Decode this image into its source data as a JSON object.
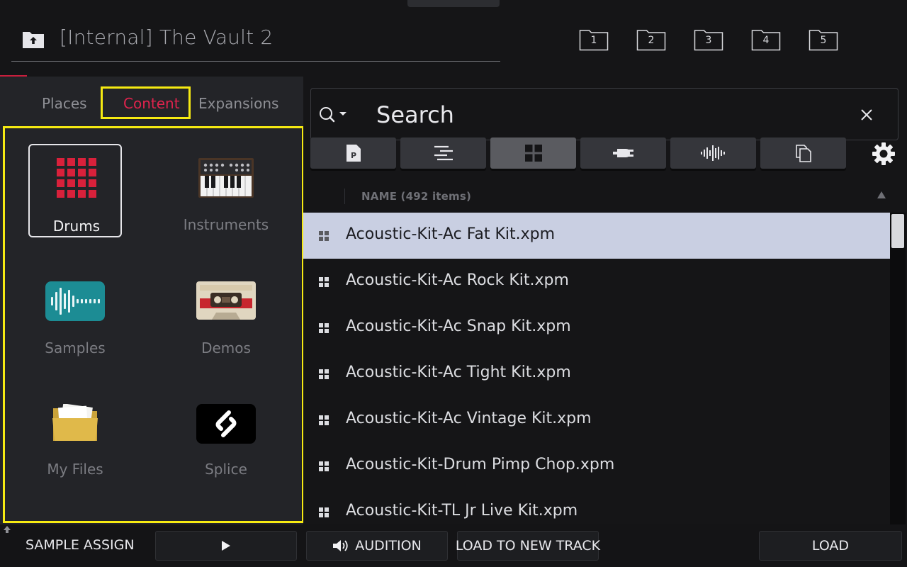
{
  "header": {
    "path_title": "[Internal] The Vault 2",
    "favorites": [
      "1",
      "2",
      "3",
      "4",
      "5"
    ]
  },
  "left": {
    "tabs": {
      "places": "Places",
      "content": "Content",
      "expansions": "Expansions"
    },
    "active_tab": "Content",
    "items": [
      {
        "label": "Drums",
        "icon": "drum-pads-icon",
        "selected": true
      },
      {
        "label": "Instruments",
        "icon": "synth-keyboard-icon"
      },
      {
        "label": "Samples",
        "icon": "waveform-icon"
      },
      {
        "label": "Demos",
        "icon": "cassette-icon"
      },
      {
        "label": "My Files",
        "icon": "folder-icon"
      },
      {
        "label": "Splice",
        "icon": "splice-logo-icon"
      }
    ]
  },
  "search": {
    "placeholder": "Search"
  },
  "filter_tabs": [
    {
      "icon": "program-file-icon"
    },
    {
      "icon": "sequence-list-icon"
    },
    {
      "icon": "kit-grid-icon",
      "active": true
    },
    {
      "icon": "plugin-icon"
    },
    {
      "icon": "sample-waveform-icon"
    },
    {
      "icon": "copy-files-icon"
    }
  ],
  "list": {
    "column_header": "NAME (492 items)",
    "rows": [
      "Acoustic-Kit-Ac Fat Kit.xpm",
      "Acoustic-Kit-Ac Rock Kit.xpm",
      "Acoustic-Kit-Ac Snap Kit.xpm",
      "Acoustic-Kit-Ac Tight Kit.xpm",
      "Acoustic-Kit-Ac Vintage Kit.xpm",
      "Acoustic-Kit-Drum Pimp Chop.xpm",
      "Acoustic-Kit-TL Jr Live Kit.xpm"
    ],
    "selected_index": 0
  },
  "footer": {
    "sample_assign": "SAMPLE ASSIGN",
    "audition": "AUDITION",
    "load_to_new_track": "LOAD TO NEW TRACK",
    "load": "LOAD"
  },
  "colors": {
    "accent_red": "#e0234d",
    "highlight_yellow": "#f6ea12",
    "selected_row": "#c9cfe2"
  }
}
